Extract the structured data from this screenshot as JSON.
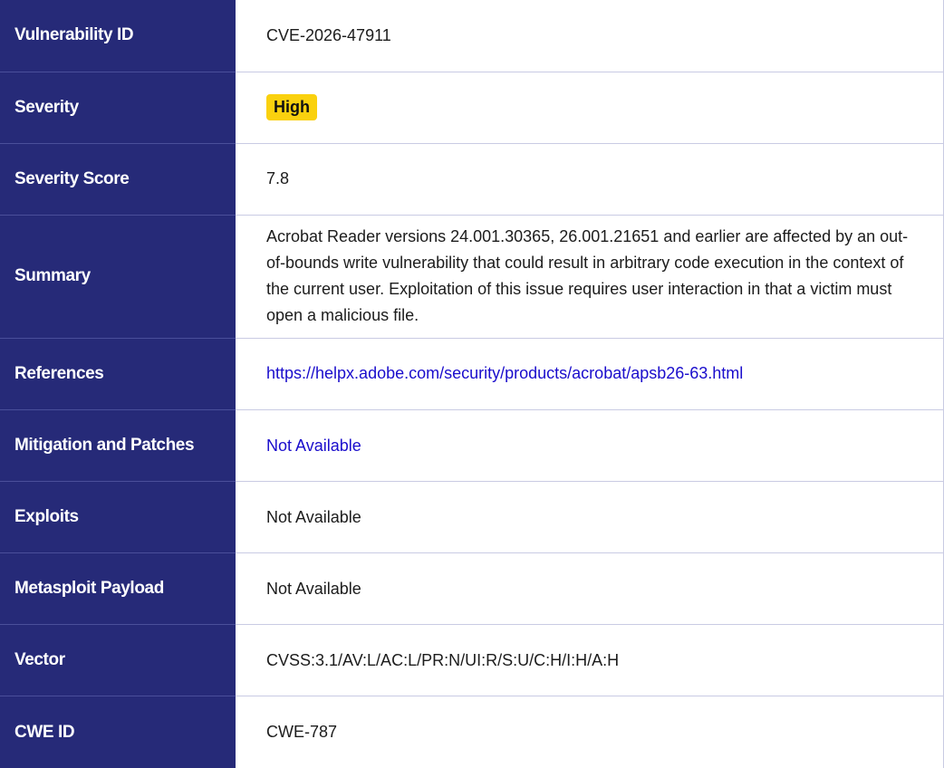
{
  "rows": {
    "vuln_id": {
      "label": "Vulnerability ID",
      "value": "CVE-2026-47911"
    },
    "severity": {
      "label": "Severity",
      "value": "High",
      "badge_color": "#fad10e"
    },
    "severity_score": {
      "label": "Severity Score",
      "value": "7.8"
    },
    "summary": {
      "label": "Summary",
      "value": "Acrobat Reader versions 24.001.30365, 26.001.21651 and earlier are affected by an out-of-bounds write vulnerability that could result in arbitrary code execution in the context of the current user. Exploitation of this issue requires user interaction in that a victim must open a malicious file."
    },
    "references": {
      "label": "References",
      "value": "https://helpx.adobe.com/security/products/acrobat/apsb26-63.html"
    },
    "mitigation": {
      "label": "Mitigation and Patches",
      "value": "Not Available"
    },
    "exploits": {
      "label": "Exploits",
      "value": "Not Available"
    },
    "metasploit": {
      "label": "Metasploit Payload",
      "value": "Not Available"
    },
    "vector": {
      "label": "Vector",
      "value": "CVSS:3.1/AV:L/AC:L/PR:N/UI:R/S:U/C:H/I:H/A:H"
    },
    "cwe_id": {
      "label": "CWE ID",
      "value": "CWE-787"
    }
  },
  "colors": {
    "label_bg": "#262a78",
    "label_text": "#ffffff",
    "link": "#1a0dcc",
    "divider": "#c9cbe3"
  }
}
